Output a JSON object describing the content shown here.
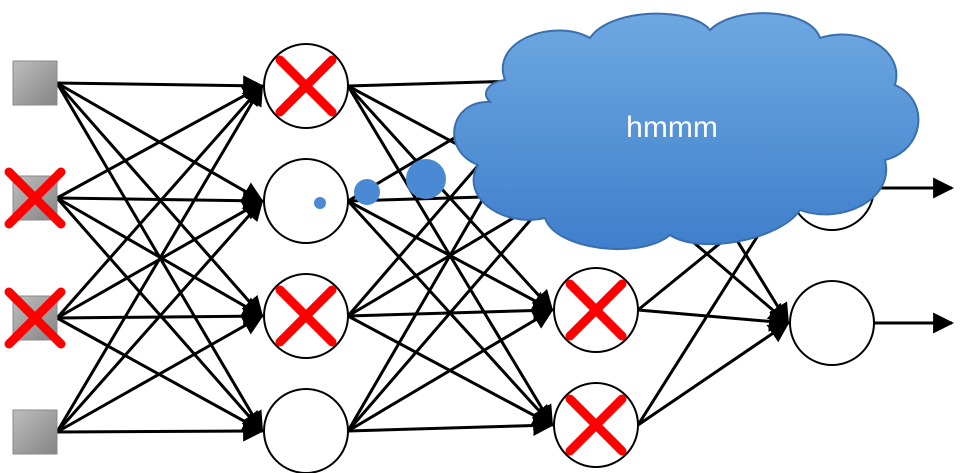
{
  "thought_bubble": {
    "text": "hmmm"
  },
  "network": {
    "layers": [
      {
        "kind": "input",
        "units": [
          {
            "dropped": false
          },
          {
            "dropped": true
          },
          {
            "dropped": true
          },
          {
            "dropped": false
          }
        ]
      },
      {
        "kind": "hidden",
        "units": [
          {
            "dropped": true
          },
          {
            "dropped": false
          },
          {
            "dropped": true
          },
          {
            "dropped": false
          }
        ]
      },
      {
        "kind": "hidden",
        "units": [
          {
            "dropped": false
          },
          {
            "dropped": false
          },
          {
            "dropped": true
          },
          {
            "dropped": true
          }
        ]
      },
      {
        "kind": "output",
        "units": [
          {
            "dropped": false
          },
          {
            "dropped": false
          }
        ]
      }
    ]
  },
  "colors": {
    "edge": "#000000",
    "drop_mark": "#ff0000",
    "input_fill": "#9a9a9a",
    "cloud_top": "#6ea8e2",
    "cloud_bottom": "#3f7fcb",
    "cloud_stroke": "#3a6fae",
    "bubble_dot": "#4a8ad4"
  }
}
